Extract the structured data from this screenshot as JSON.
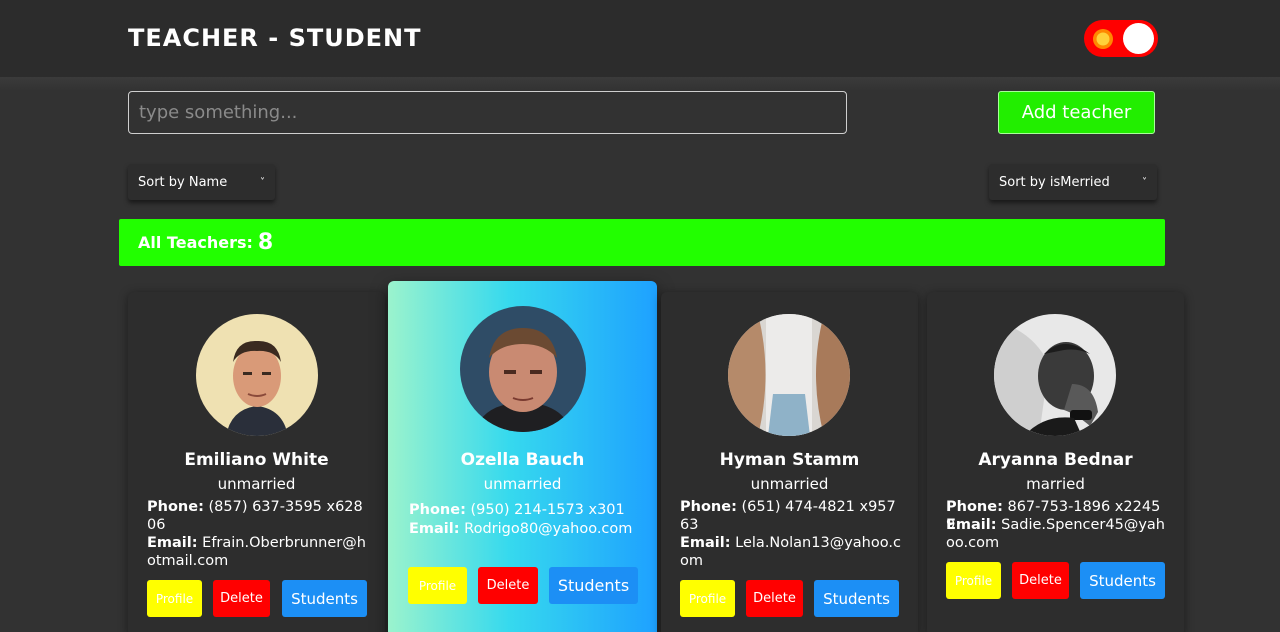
{
  "header": {
    "title": "TEACHER - STUDENT",
    "theme_toggle": {
      "icon": "sun-icon",
      "state": "on",
      "color": "#ff0000"
    }
  },
  "search": {
    "placeholder": "type something...",
    "value": ""
  },
  "add_teacher_label": "Add teacher",
  "sort": {
    "name_label": "Sort by Name",
    "married_label": "Sort by isMerried"
  },
  "summary": {
    "label": "All Teachers:",
    "count": "8"
  },
  "buttons": {
    "profile": "Profile",
    "delete": "Delete",
    "students": "Students"
  },
  "labels": {
    "phone": "Phone:",
    "email": "Email:"
  },
  "teachers": [
    {
      "name": "Emiliano White",
      "status": "unmarried",
      "phone": "(857) 637-3595 x62806",
      "email": "Efrain.Oberbrunner@hotmail.com"
    },
    {
      "name": "Ozella Bauch",
      "status": "unmarried",
      "phone": "(950) 214-1573 x301",
      "email": "Rodrigo80@yahoo.com"
    },
    {
      "name": "Hyman Stamm",
      "status": "unmarried",
      "phone": "(651) 474-4821 x95763",
      "email": "Lela.Nolan13@yahoo.com"
    },
    {
      "name": "Aryanna Bednar",
      "status": "married",
      "phone": "867-753-1896 x22459",
      "email": "Sadie.Spencer45@yahoo.com"
    }
  ],
  "colors": {
    "accent_green": "#22ff00",
    "profile_yellow": "#ffff00",
    "delete_red": "#ff0000",
    "students_blue": "#1c8ff5"
  }
}
